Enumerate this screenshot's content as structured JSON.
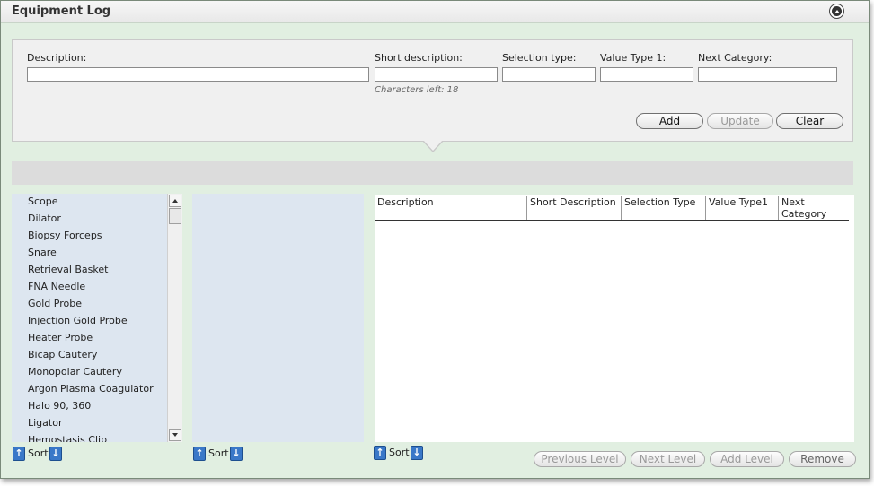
{
  "window": {
    "title": "Equipment Log"
  },
  "form": {
    "description_label": "Description:",
    "description_value": "",
    "short_label": "Short description:",
    "short_value": "",
    "chars_left": "Characters left: 18",
    "selection_label": "Selection type:",
    "selection_value": "",
    "value1_label": "Value Type 1:",
    "value1_value": "",
    "next_cat_label": "Next Category:",
    "next_cat_value": "",
    "add_label": "Add",
    "update_label": "Update",
    "clear_label": "Clear"
  },
  "list1": {
    "items": [
      "Scope",
      "Dilator",
      "Biopsy Forceps",
      "Snare",
      "Retrieval Basket",
      "FNA Needle",
      "Gold Probe",
      "Injection Gold Probe",
      "Heater Probe",
      "Bicap Cautery",
      "Monopolar Cautery",
      "Argon Plasma Coagulator",
      "Halo 90, 360",
      "Ligator",
      "Hemostasis Clip"
    ]
  },
  "grid": {
    "columns": [
      "Description",
      "Short Description",
      "Selection Type",
      "Value Type1",
      "Next Category"
    ]
  },
  "sort": {
    "label": "Sort",
    "up_icon": "up-arrow-icon",
    "down_icon": "down-arrow-icon"
  },
  "actions": {
    "previous": "Previous Level",
    "next": "Next Level",
    "add": "Add Level",
    "remove": "Remove"
  }
}
